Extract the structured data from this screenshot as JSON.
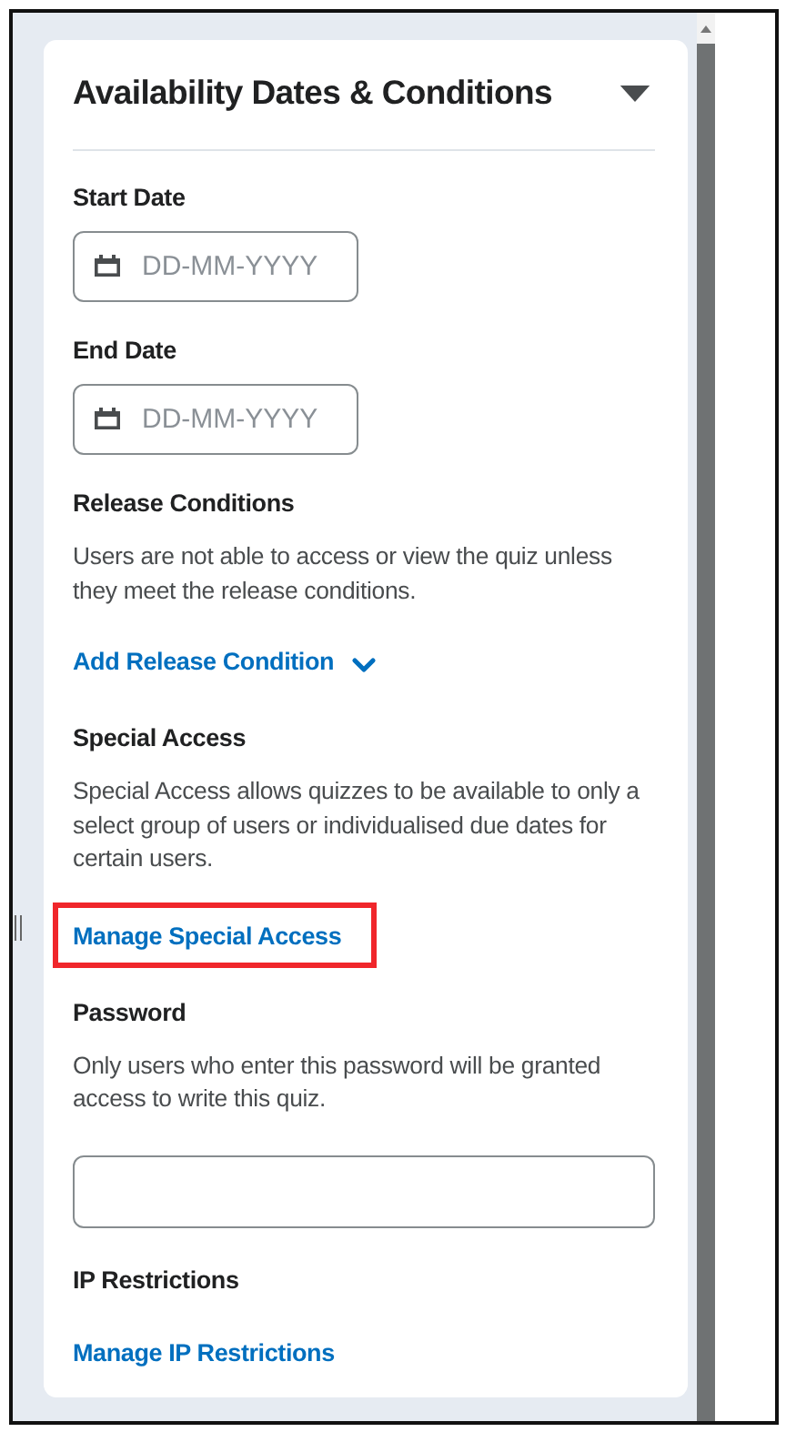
{
  "panel": {
    "title": "Availability Dates & Conditions",
    "expanded": true
  },
  "sections": [
    {
      "kind": "date",
      "label": "Start Date",
      "placeholder": "DD-MM-YYYY"
    },
    {
      "kind": "date",
      "label": "End Date",
      "placeholder": "DD-MM-YYYY"
    },
    {
      "kind": "link",
      "label": "Release Conditions",
      "description": "Users are not able to access or view the quiz unless they meet the release conditions.",
      "link": "Add Release Condition",
      "dropdown": true,
      "highlighted": false
    },
    {
      "kind": "link",
      "label": "Special Access",
      "description": "Special Access allows quizzes to be available to only a select group of users or individualised due dates for certain users.",
      "link": "Manage Special Access",
      "dropdown": false,
      "highlighted": true
    },
    {
      "kind": "password",
      "label": "Password",
      "description": "Only users who enter this password will be granted access to write this quiz."
    },
    {
      "kind": "link",
      "label": "IP Restrictions",
      "link": "Manage IP Restrictions",
      "dropdown": false,
      "highlighted": false
    }
  ]
}
